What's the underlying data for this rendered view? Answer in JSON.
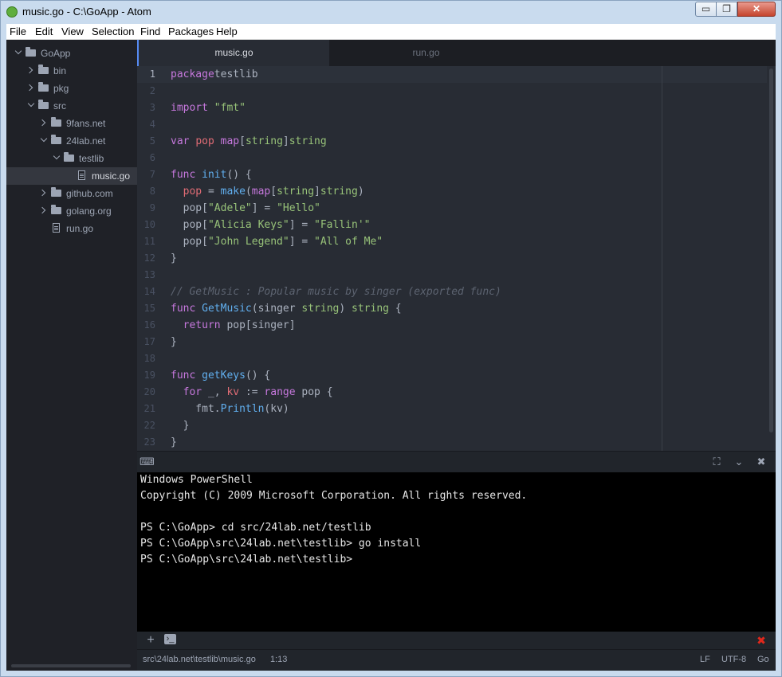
{
  "window": {
    "title": "music.go - C:\\GoApp - Atom",
    "min_symbol": "▭",
    "max_symbol": "❐",
    "close_symbol": "✕"
  },
  "menu": [
    "File",
    "Edit",
    "View",
    "Selection",
    "Find",
    "Packages",
    "Help"
  ],
  "tree": [
    {
      "label": "GoApp",
      "type": "folder",
      "open": true,
      "depth": 0
    },
    {
      "label": "bin",
      "type": "folder",
      "open": false,
      "depth": 1
    },
    {
      "label": "pkg",
      "type": "folder",
      "open": false,
      "depth": 1
    },
    {
      "label": "src",
      "type": "folder",
      "open": true,
      "depth": 1
    },
    {
      "label": "9fans.net",
      "type": "folder",
      "open": false,
      "depth": 2
    },
    {
      "label": "24lab.net",
      "type": "folder",
      "open": true,
      "depth": 2
    },
    {
      "label": "testlib",
      "type": "folder",
      "open": true,
      "depth": 3
    },
    {
      "label": "music.go",
      "type": "file",
      "depth": 4,
      "selected": true
    },
    {
      "label": "github.com",
      "type": "folder",
      "open": false,
      "depth": 2
    },
    {
      "label": "golang.org",
      "type": "folder",
      "open": false,
      "depth": 2
    },
    {
      "label": "run.go",
      "type": "file",
      "depth": 2
    }
  ],
  "tabs": [
    {
      "label": "music.go",
      "active": true
    },
    {
      "label": "run.go",
      "active": false
    }
  ],
  "code": [
    [
      [
        "kw",
        "package"
      ],
      [
        "",
        "testlib"
      ]
    ],
    [],
    [
      [
        "kw",
        "import"
      ],
      [
        "",
        ""
      ],
      [
        "str",
        "\"fmt\""
      ]
    ],
    [],
    [
      [
        "kw",
        "var"
      ],
      [
        "",
        ""
      ],
      [
        "var",
        "pop"
      ],
      [
        "",
        ""
      ],
      [
        "kw",
        "map"
      ],
      [
        "",
        "["
      ],
      [
        "ty",
        "string"
      ],
      [
        "",
        "]"
      ],
      [
        "ty",
        "string"
      ]
    ],
    [],
    [
      [
        "kw",
        "func"
      ],
      [
        "",
        ""
      ],
      [
        "fn",
        "init"
      ],
      [
        "",
        "() {"
      ]
    ],
    [
      [
        "",
        "  "
      ],
      [
        "var",
        "pop"
      ],
      [
        "",
        " = "
      ],
      [
        "fn",
        "make"
      ],
      [
        "",
        "("
      ],
      [
        "kw",
        "map"
      ],
      [
        "",
        "["
      ],
      [
        "ty",
        "string"
      ],
      [
        "",
        "]"
      ],
      [
        "ty",
        "string"
      ],
      [
        "",
        ")"
      ]
    ],
    [
      [
        "",
        "  pop["
      ],
      [
        "str",
        "\"Adele\""
      ],
      [
        "",
        "] = "
      ],
      [
        "str",
        "\"Hello\""
      ]
    ],
    [
      [
        "",
        "  pop["
      ],
      [
        "str",
        "\"Alicia Keys\""
      ],
      [
        "",
        "] = "
      ],
      [
        "str",
        "\"Fallin'\""
      ]
    ],
    [
      [
        "",
        "  pop["
      ],
      [
        "str",
        "\"John Legend\""
      ],
      [
        "",
        "] = "
      ],
      [
        "str",
        "\"All of Me\""
      ]
    ],
    [
      [
        "",
        "}"
      ]
    ],
    [],
    [
      [
        "cm",
        "// GetMusic : Popular music by singer (exported func)"
      ]
    ],
    [
      [
        "kw",
        "func"
      ],
      [
        "",
        ""
      ],
      [
        "fn",
        "GetMusic"
      ],
      [
        "",
        "(singer "
      ],
      [
        "ty",
        "string"
      ],
      [
        "",
        ") "
      ],
      [
        "ty",
        "string"
      ],
      [
        "",
        " {"
      ]
    ],
    [
      [
        "",
        "  "
      ],
      [
        "kw",
        "return"
      ],
      [
        "",
        " pop[singer]"
      ]
    ],
    [
      [
        "",
        "}"
      ]
    ],
    [],
    [
      [
        "kw",
        "func"
      ],
      [
        "",
        ""
      ],
      [
        "fn",
        "getKeys"
      ],
      [
        "",
        "() {"
      ]
    ],
    [
      [
        "",
        "  "
      ],
      [
        "kw",
        "for"
      ],
      [
        "",
        " _, "
      ],
      [
        "var",
        "kv"
      ],
      [
        "",
        " := "
      ],
      [
        "kw",
        "range"
      ],
      [
        "",
        " pop {"
      ]
    ],
    [
      [
        "",
        "    fmt."
      ],
      [
        "fn",
        "Println"
      ],
      [
        "",
        "(kv)"
      ]
    ],
    [
      [
        "",
        "  }"
      ]
    ],
    [
      [
        "",
        "}"
      ]
    ]
  ],
  "terminal": {
    "lines": [
      "Windows PowerShell",
      "Copyright (C) 2009 Microsoft Corporation. All rights reserved.",
      "",
      "PS C:\\GoApp> cd src/24lab.net/testlib",
      "PS C:\\GoApp\\src\\24lab.net\\testlib> go install",
      "PS C:\\GoApp\\src\\24lab.net\\testlib>"
    ],
    "icons": {
      "keyboard": "⌨",
      "maximize": "⛶",
      "hide": "⌄",
      "close": "✖",
      "add": "+",
      "prompt": "›_",
      "kill": "✖"
    }
  },
  "status": {
    "path": "src\\24lab.net\\testlib\\music.go",
    "cursor": "1:13",
    "line_ending": "LF",
    "encoding": "UTF-8",
    "grammar": "Go"
  },
  "colors": {
    "accent": "#568af2",
    "editor_bg": "#282c34",
    "close_red": "#e0281c"
  }
}
